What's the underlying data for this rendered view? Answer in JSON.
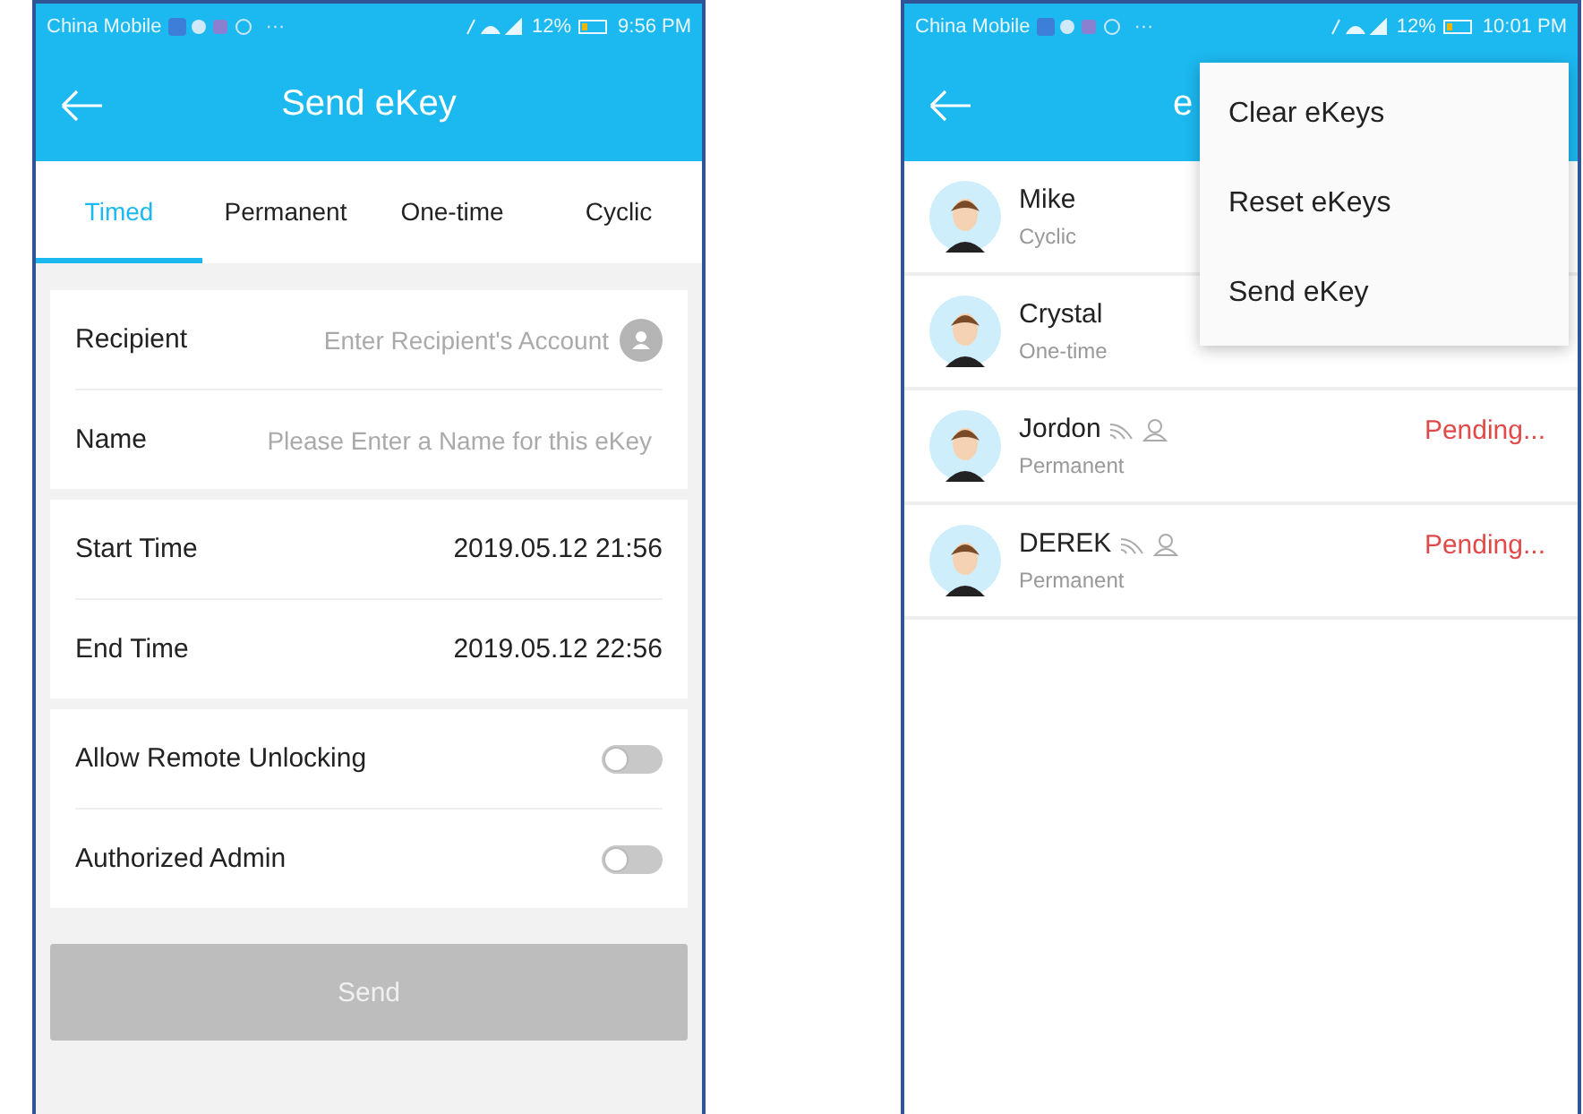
{
  "left_phone": {
    "status_bar": {
      "carrier": "China Mobile",
      "dots": "···",
      "battery": "12%",
      "time": "9:56 PM"
    },
    "title": "Send eKey",
    "tabs": [
      {
        "label": "Timed",
        "selected": true
      },
      {
        "label": "Permanent",
        "selected": false
      },
      {
        "label": "One-time",
        "selected": false
      },
      {
        "label": "Cyclic",
        "selected": false
      }
    ],
    "recipient": {
      "label": "Recipient",
      "placeholder": "Enter Recipient's Account"
    },
    "name": {
      "label": "Name",
      "placeholder": "Please Enter a Name for this eKey"
    },
    "times": [
      {
        "label": "Start Time",
        "value": "2019.05.12 21:56"
      },
      {
        "label": "End Time",
        "value": "2019.05.12 22:56"
      }
    ],
    "switches": [
      {
        "label": "Allow Remote Unlocking",
        "on": false
      },
      {
        "label": "Authorized Admin",
        "on": false
      }
    ],
    "send_button": {
      "label": "Send",
      "disabled": true
    }
  },
  "right_phone": {
    "status_bar": {
      "carrier": "China Mobile",
      "dots": "···",
      "battery": "12%",
      "time": "10:01 PM"
    },
    "title": "e",
    "ekeys": [
      {
        "name": "Mike",
        "type": "Cyclic",
        "remote": false,
        "admin": false
      },
      {
        "name": "Crystal",
        "type": "One-time",
        "remote": false,
        "admin": false
      },
      {
        "name": "Jordon",
        "type": "Permanent",
        "remote": true,
        "admin": true,
        "status": "Pending..."
      },
      {
        "name": "DEREK",
        "type": "Permanent",
        "remote": true,
        "admin": true,
        "status": "Pending..."
      }
    ],
    "menu": [
      "Clear eKeys",
      "Reset eKeys",
      "Send eKey"
    ]
  }
}
